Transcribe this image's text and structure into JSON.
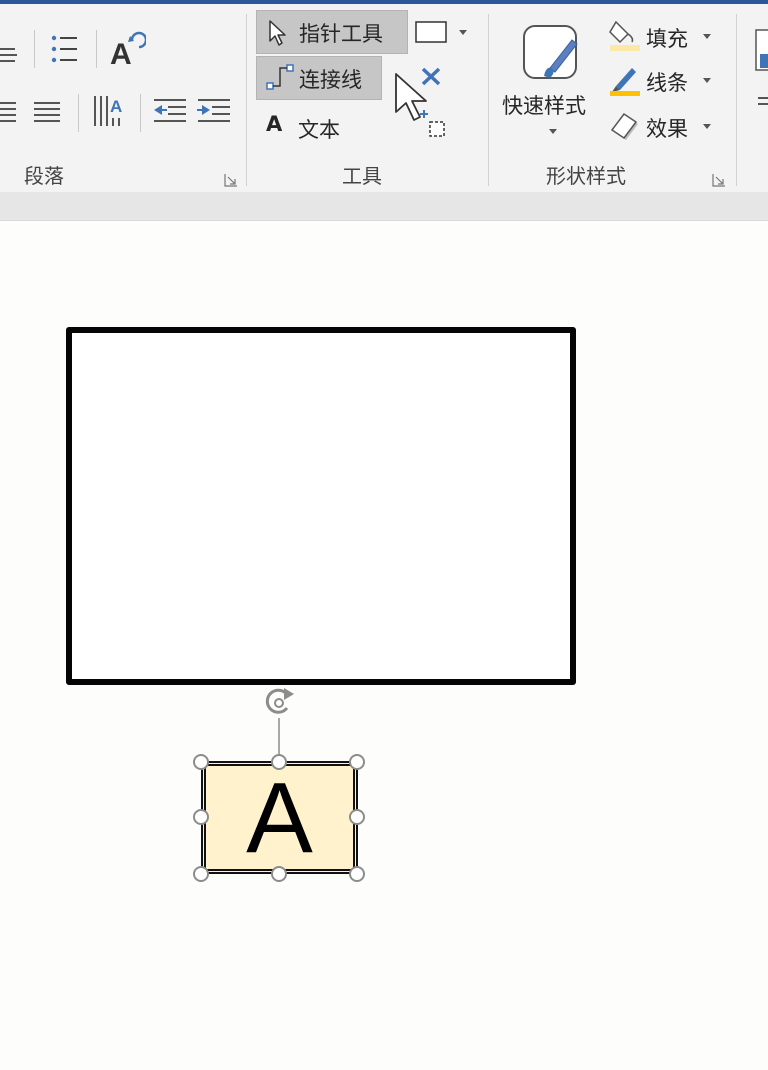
{
  "ribbon": {
    "groups": {
      "paragraph": "段落",
      "tools": "工具",
      "shape_styles": "形状样式"
    },
    "tools": {
      "pointer_tool": "指针工具",
      "connector": "连接线",
      "text": "文本",
      "text_glyph": "A"
    },
    "shape_styles": {
      "quick_styles": "快速样式",
      "fill": "填充",
      "line": "线条",
      "effects": "效果"
    }
  },
  "canvas": {
    "shape_a_text": "A"
  },
  "colors": {
    "accent": "#2b579a",
    "selected_tool_bg": "#c6c6c6",
    "shape_fill": "#fff2cc",
    "icon_blue": "#3f74b6",
    "fill_swatch": "#fde9a6",
    "line_swatch": "#ffc000"
  }
}
